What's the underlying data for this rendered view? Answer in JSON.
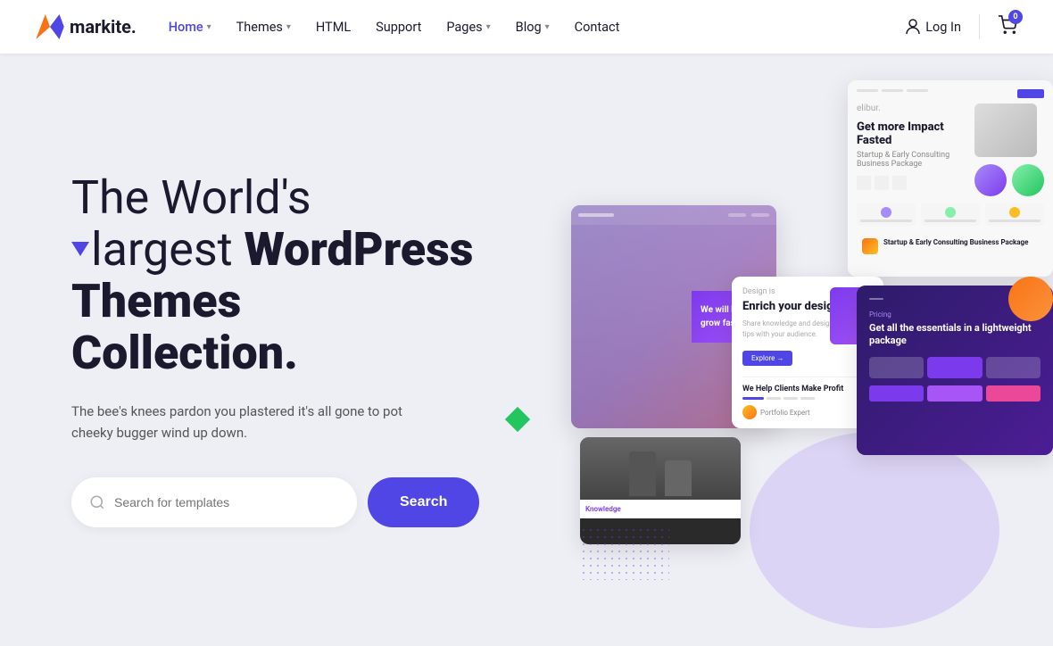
{
  "logo": {
    "text": "markite.",
    "dot_color": "#4f46e5"
  },
  "nav": {
    "links": [
      {
        "label": "Home",
        "has_chevron": true,
        "active": true
      },
      {
        "label": "Themes",
        "has_chevron": true,
        "active": false
      },
      {
        "label": "HTML",
        "has_chevron": false,
        "active": false
      },
      {
        "label": "Support",
        "has_chevron": false,
        "active": false
      },
      {
        "label": "Pages",
        "has_chevron": true,
        "active": false
      },
      {
        "label": "Blog",
        "has_chevron": true,
        "active": false
      },
      {
        "label": "Contact",
        "has_chevron": false,
        "active": false
      }
    ],
    "login_label": "Log In",
    "cart_count": "0"
  },
  "hero": {
    "heading_line1": "The World's",
    "heading_line2_normal": "largest ",
    "heading_line2_bold": "WordPress",
    "heading_line3": "Themes",
    "heading_line4": "Collection.",
    "subtext": "The bee's knees pardon you plastered it's all gone to pot cheeky bugger wind up down.",
    "search_placeholder": "Search for templates",
    "search_button_label": "Search"
  },
  "screenshots": {
    "big_text": "We will help you grow fast",
    "tr_title": "Get more Impact Fasted",
    "tr_sub": "Startup & Early Consulting Business Package",
    "mid_title": "Enrich your design",
    "mid_text": "We Help Clients Make Profit",
    "br_tag": "Pricing",
    "br_title": "Get all the essentials in a lightweight package",
    "bot_label": "Knowledge"
  },
  "colors": {
    "accent": "#4f46e5",
    "bg": "#eeeef5",
    "text_dark": "#1a1a2e",
    "green_diamond": "#22c55e"
  }
}
